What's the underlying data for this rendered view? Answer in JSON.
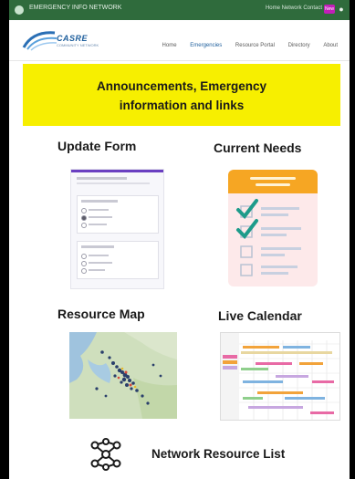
{
  "browser": {
    "site_title": "EMERGENCY INFO NETWORK",
    "right_links": "Home  Network  Contact",
    "badge": "New",
    "menu_icon": "user-icon"
  },
  "header": {
    "logo_text": "CASRE",
    "logo_sub": "COMMUNITY NETWORK",
    "nav": [
      "Home",
      "Emergencies",
      "Resource Portal",
      "Directory",
      "About"
    ],
    "active_nav": "Emergencies"
  },
  "banner": {
    "line1": "Announcements, Emergency",
    "line2": "information and links",
    "background": "#f7ef00"
  },
  "tiles": {
    "update_form": {
      "title": "Update Form",
      "icon": "form-icon"
    },
    "current_needs": {
      "title": "Current Needs",
      "icon": "checklist-icon",
      "accent": "#f6a623",
      "check_color": "#1e9b8a"
    },
    "resource_map": {
      "title": "Resource Map",
      "icon": "map-icon"
    },
    "live_calendar": {
      "title": "Live Calendar",
      "icon": "calendar-icon"
    },
    "network_resources": {
      "title": "Network Resource List",
      "icon": "network-icon"
    }
  },
  "colors": {
    "browser_bar": "#2f6b3c",
    "brand_blue": "#1d5e9c",
    "form_accent": "#6a3fc1"
  }
}
